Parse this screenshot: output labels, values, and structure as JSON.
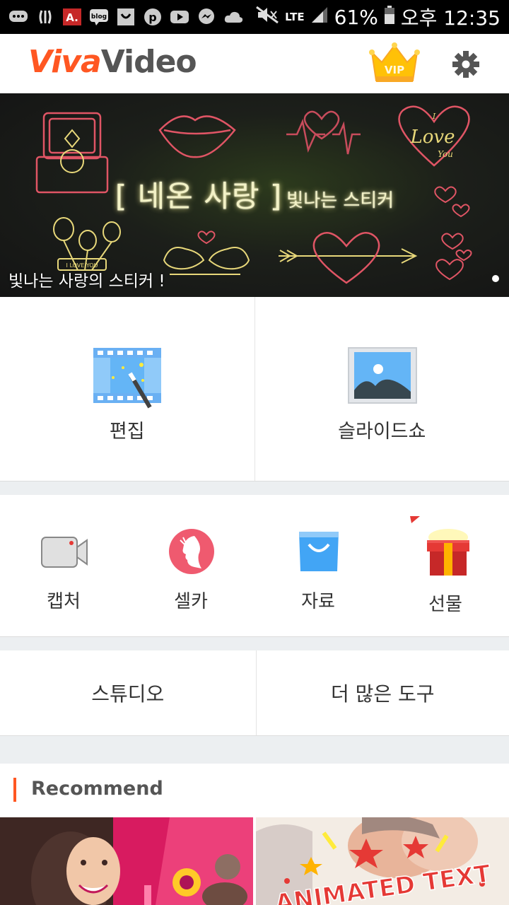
{
  "status_bar": {
    "network": "LTE",
    "battery": "61%",
    "time": "오후 12:35"
  },
  "app": {
    "logo_part1": "Viva",
    "logo_part2": "Video",
    "vip_label": "VIP"
  },
  "banner": {
    "title_main": "[ 네온 사랑 ]",
    "title_sub": "빛나는 스티커",
    "caption": "빛나는 사랑의 스티커 !",
    "deco_text_love": "Love",
    "deco_text_i": "I",
    "deco_text_you": "You",
    "deco_text_ribbon": "I LOVE YOU"
  },
  "main_actions": [
    {
      "label": "편집",
      "icon": "film-edit-icon"
    },
    {
      "label": "슬라이드쇼",
      "icon": "image-icon"
    }
  ],
  "tools": [
    {
      "label": "캡처",
      "icon": "video-camera-icon"
    },
    {
      "label": "셀카",
      "icon": "selfie-icon"
    },
    {
      "label": "자료",
      "icon": "shopping-bag-icon"
    },
    {
      "label": "선물",
      "icon": "gift-icon"
    }
  ],
  "secondary": [
    {
      "label": "스튜디오"
    },
    {
      "label": "더 많은 도구"
    }
  ],
  "recommend": {
    "title": "Recommend",
    "thumb2_text": "ANIMATED TEXT"
  },
  "colors": {
    "accent": "#ff5722",
    "statusbar": "#000000"
  }
}
